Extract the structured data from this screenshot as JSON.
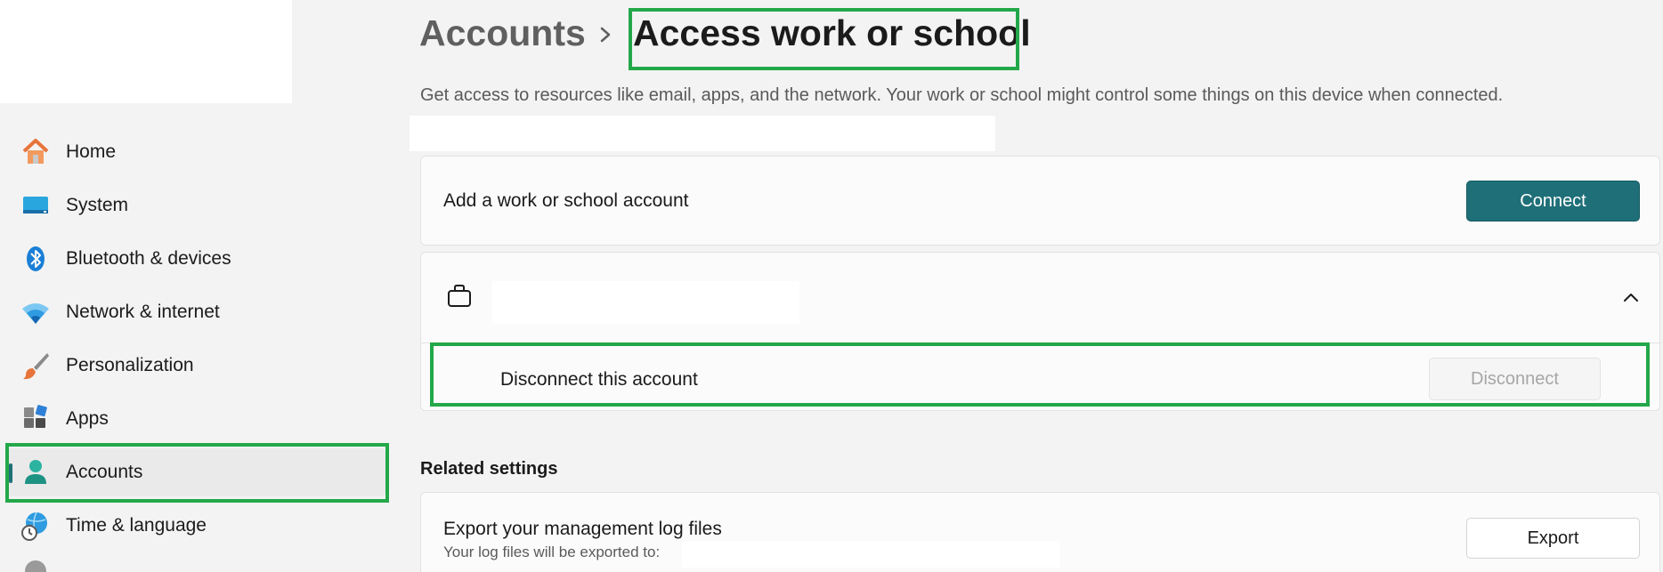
{
  "sidebar": {
    "items": [
      {
        "label": "Home",
        "icon": "home-icon"
      },
      {
        "label": "System",
        "icon": "system-icon"
      },
      {
        "label": "Bluetooth & devices",
        "icon": "bluetooth-icon"
      },
      {
        "label": "Network & internet",
        "icon": "wifi-icon"
      },
      {
        "label": "Personalization",
        "icon": "brush-icon"
      },
      {
        "label": "Apps",
        "icon": "apps-icon"
      },
      {
        "label": "Accounts",
        "icon": "person-icon",
        "selected": true
      },
      {
        "label": "Time & language",
        "icon": "globe-clock-icon"
      }
    ]
  },
  "header": {
    "parent": "Accounts",
    "title": "Access work or school",
    "description": "Get access to resources like email, apps, and the network. Your work or school might control some things on this device when connected."
  },
  "add_account": {
    "label": "Add a work or school account",
    "button": "Connect"
  },
  "account": {
    "icon": "briefcase-icon",
    "disconnect_label": "Disconnect this account",
    "disconnect_button": "Disconnect"
  },
  "related": {
    "title": "Related settings",
    "export_label": "Export your management log files",
    "export_sub": "Your log files will be exported to:",
    "export_button": "Export"
  },
  "colors": {
    "accent": "#1f6f78",
    "highlight": "#23a849"
  }
}
